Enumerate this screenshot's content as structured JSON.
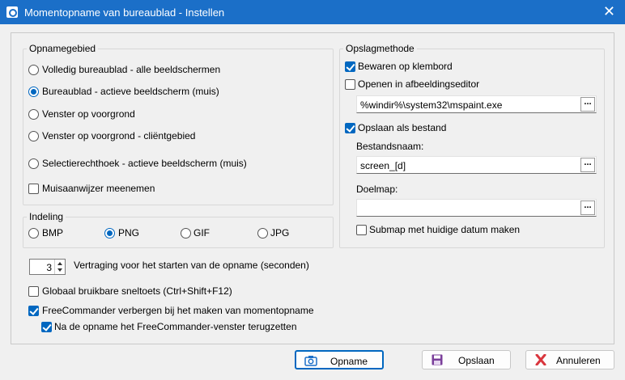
{
  "window": {
    "title": "Momentopname van bureaublad - Instellen"
  },
  "capture_area": {
    "legend": "Opnamegebied",
    "options": [
      {
        "label": "Volledig bureaublad - alle beeldschermen",
        "selected": false
      },
      {
        "label": "Bureaublad - actieve beeldscherm (muis)",
        "selected": true
      },
      {
        "label": "Venster op voorgrond",
        "selected": false
      },
      {
        "label": "Venster op voorgrond - cliëntgebied",
        "selected": false
      },
      {
        "label": "Selectierechthoek - actieve beeldscherm (muis)",
        "selected": false
      }
    ],
    "include_cursor": {
      "label": "Muisaanwijzer meenemen",
      "checked": false
    }
  },
  "format": {
    "legend": "Indeling",
    "options": [
      {
        "label": "BMP",
        "selected": false
      },
      {
        "label": "PNG",
        "selected": true
      },
      {
        "label": "GIF",
        "selected": false
      },
      {
        "label": "JPG",
        "selected": false
      }
    ]
  },
  "storage": {
    "legend": "Opslagmethode",
    "clipboard": {
      "label": "Bewaren op klembord",
      "checked": true
    },
    "open_editor": {
      "label": "Openen in afbeeldingseditor",
      "checked": false
    },
    "editor_path": "%windir%\\system32\\mspaint.exe",
    "save_file": {
      "label": "Opslaan als bestand",
      "checked": true
    },
    "filename_label": "Bestandsnaam:",
    "filename": "screen_[d]",
    "target_label": "Doelmap:",
    "target": "",
    "subfolder": {
      "label": "Submap met huidige datum maken",
      "checked": false
    },
    "browse_label": "..."
  },
  "delay": {
    "value": "3",
    "label": "Vertraging voor het starten van de opname (seconden)"
  },
  "hotkey": {
    "label": "Globaal bruikbare sneltoets (Ctrl+Shift+F12)",
    "checked": false
  },
  "hide": {
    "label": "FreeCommander verbergen bij het maken van momentopname",
    "checked": true
  },
  "restore": {
    "label": "Na de opname het FreeCommander-venster terugzetten",
    "checked": true
  },
  "buttons": {
    "capture": "Opname",
    "save": "Opslaan",
    "cancel": "Annuleren"
  },
  "colors": {
    "titlebar": "#1b6fc8",
    "accent": "#0067c0",
    "cancel_icon": "#d9363e"
  }
}
